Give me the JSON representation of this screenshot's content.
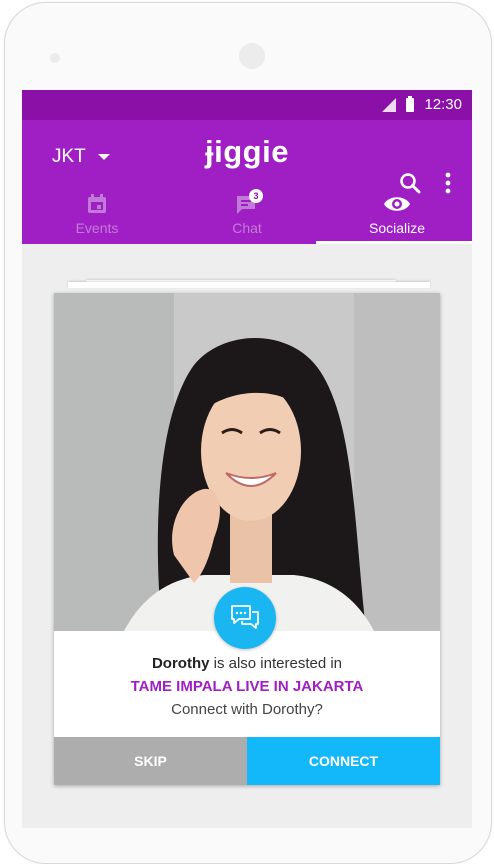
{
  "statusbar": {
    "time": "12:30"
  },
  "appbar": {
    "city": "JKT",
    "logo": "ɉiggie"
  },
  "tabs": [
    {
      "label": "Events",
      "icon": "calendar-icon"
    },
    {
      "label": "Chat",
      "icon": "chat-icon",
      "badge": "3"
    },
    {
      "label": "Socialize",
      "icon": "eye-icon",
      "active": true
    }
  ],
  "card": {
    "name": "Dorothy",
    "interest_text": " is also interested in",
    "event": "TAME IMPALA LIVE IN JAKARTA",
    "prompt": "Connect with Dorothy?",
    "skip_label": "SKIP",
    "connect_label": "CONNECT"
  },
  "colors": {
    "statusbar": "#8a10a8",
    "appbar": "#a01fc4",
    "accent": "#13b8fa",
    "skip": "#adadad"
  }
}
